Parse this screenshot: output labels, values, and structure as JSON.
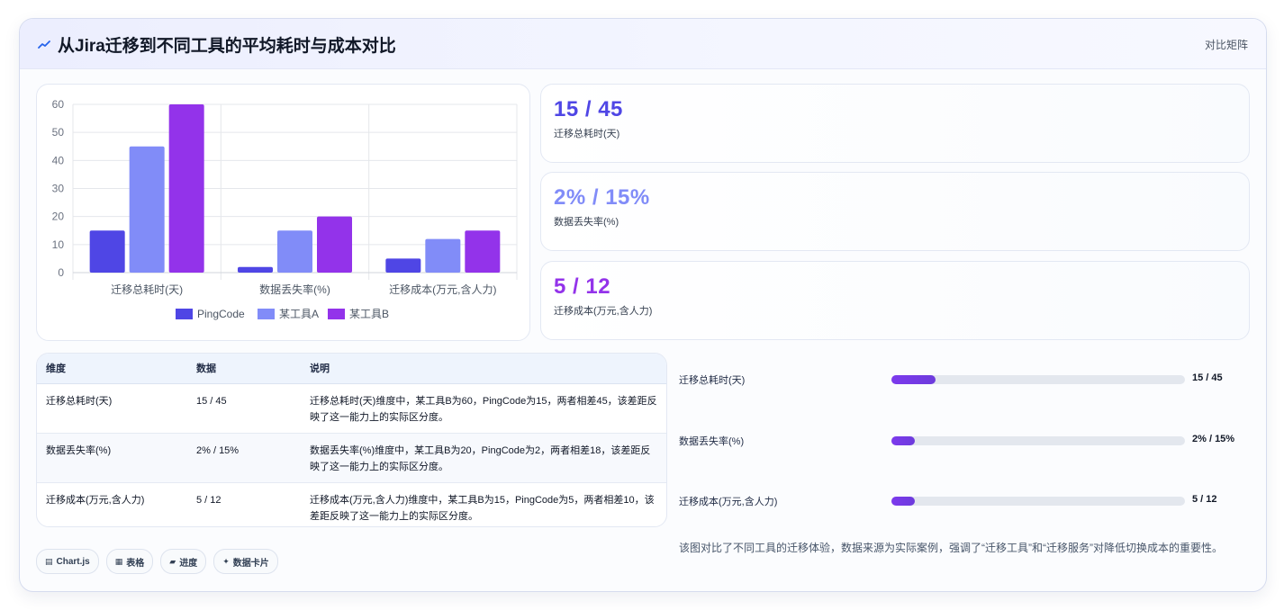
{
  "header": {
    "icon": "zigzag-icon",
    "title": "从Jira迁移到不同工具的平均耗时与成本对比",
    "tag": "对比矩阵"
  },
  "colors": {
    "pingcode": "#4f46e5",
    "toolA": "#818cf8",
    "toolB": "#9333ea"
  },
  "chart_data": {
    "type": "bar",
    "categories": [
      "迁移总耗时(天)",
      "数据丢失率(%)",
      "迁移成本(万元,含人力)"
    ],
    "series": [
      {
        "name": "PingCode",
        "values": [
          15,
          2,
          5
        ]
      },
      {
        "name": "某工具A",
        "values": [
          45,
          15,
          12
        ]
      },
      {
        "name": "某工具B",
        "values": [
          60,
          20,
          15
        ]
      }
    ],
    "yticks": [
      "0",
      "10",
      "20",
      "30",
      "40",
      "50",
      "60"
    ],
    "ylim": [
      0,
      60
    ],
    "grid": true,
    "legend_position": "bottom"
  },
  "kpis": [
    {
      "value": "15 / 45",
      "label": "迁移总耗时(天)"
    },
    {
      "value": "2% / 15%",
      "label": "数据丢失率(%)"
    },
    {
      "value": "5 / 12",
      "label": "迁移成本(万元,含人力)"
    }
  ],
  "table": {
    "headers": [
      "维度",
      "数据",
      "说明"
    ],
    "rows": [
      {
        "dim": "迁移总耗时(天)",
        "data": "15 / 45",
        "desc": "迁移总耗时(天)维度中，某工具B为60，PingCode为15，两者相差45，该差距反映了这一能力上的实际区分度。"
      },
      {
        "dim": "数据丢失率(%)",
        "data": "2% / 15%",
        "desc": "数据丢失率(%)维度中，某工具B为20，PingCode为2，两者相差18，该差距反映了这一能力上的实际区分度。"
      },
      {
        "dim": "迁移成本(万元,含人力)",
        "data": "5 / 12",
        "desc": "迁移成本(万元,含人力)维度中，某工具B为15，PingCode为5，两者相差10，该差距反映了这一能力上的实际区分度。"
      }
    ]
  },
  "progress": [
    {
      "label": "迁移总耗时(天)",
      "value": "15 / 45",
      "fraction": 0.15
    },
    {
      "label": "数据丢失率(%)",
      "value": "2% / 15%",
      "fraction": 0.08
    },
    {
      "label": "迁移成本(万元,含人力)",
      "value": "5 / 12",
      "fraction": 0.08
    }
  ],
  "note": "该图对比了不同工具的迁移体验，数据来源为实际案例，强调了“迁移工具”和“迁移服务”对降低切换成本的重要性。",
  "chips": [
    {
      "icon": "chart-icon",
      "glyph": "▤",
      "label": "Chart.js"
    },
    {
      "icon": "table-icon",
      "glyph": "▦",
      "label": "表格"
    },
    {
      "icon": "progress-icon",
      "glyph": "▰",
      "label": "进度"
    },
    {
      "icon": "sparkle-icon",
      "glyph": "✦",
      "label": "数据卡片"
    }
  ]
}
